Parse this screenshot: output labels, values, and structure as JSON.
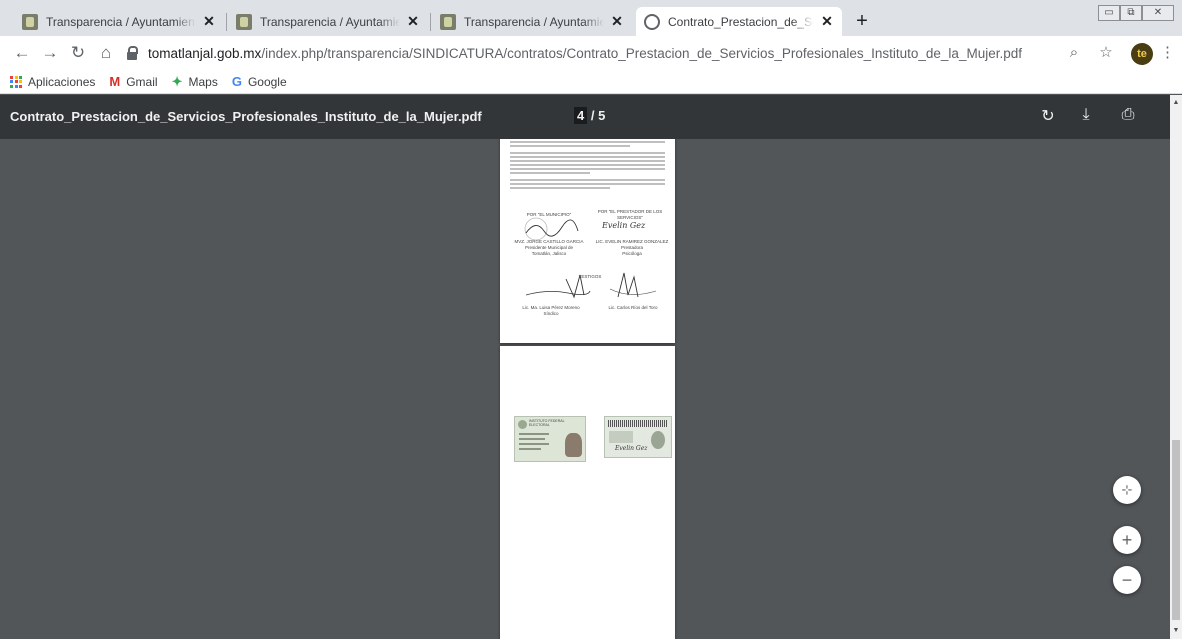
{
  "tabs": [
    {
      "title": "Transparencia / Ayuntamiento de",
      "active": false
    },
    {
      "title": "Transparencia / Ayuntamiento de",
      "active": false
    },
    {
      "title": "Transparencia / Ayuntamiento de",
      "active": false
    },
    {
      "title": "Contrato_Prestacion_de_Servicios",
      "active": true
    }
  ],
  "tab_close_glyph": "✕",
  "new_tab_glyph": "+",
  "address": {
    "domain": "tomatlanjal.gob.mx",
    "path": "/index.php/transparencia/SINDICATURA/contratos/Contrato_Prestacion_de_Servicios_Profesionales_Instituto_de_la_Mujer.pdf"
  },
  "profile_initials": "te",
  "bookmarks": [
    {
      "label": "Aplicaciones",
      "icon": "apps-grid-icon"
    },
    {
      "label": "Gmail",
      "icon": "gmail-icon",
      "glyph": "M",
      "color": "#d93025"
    },
    {
      "label": "Maps",
      "icon": "maps-pin-icon",
      "glyph": "✦",
      "color": "#34a853"
    },
    {
      "label": "Google",
      "icon": "google-g-icon",
      "glyph": "G",
      "color": "#4285f4"
    }
  ],
  "pdf": {
    "filename": "Contrato_Prestacion_de_Servicios_Profesionales_Instituto_de_la_Mujer.pdf",
    "current_page": "4",
    "page_separator": "/ 5"
  },
  "signature_page": {
    "label_municipio": "POR \"EL MUNICIPIO\"",
    "label_prestador_1": "POR \"EL PRESTADOR DE LOS",
    "label_prestador_2": "SERVICIOS\"",
    "name_left": "MVZ. JORGE CASTILLO GARCIA",
    "role_left_1": "Presidente Municipal de",
    "role_left_2": "Tomatlán, Jalisco",
    "name_right": "LIC. EVELIN RAMIREZ GONZALEZ",
    "role_right_1": "Prestadora",
    "role_right_2": "Psicóloga",
    "label_testigos": "TESTIGOS",
    "name_witness_left": "Lic. Ma. Luisa Pérez Moreno",
    "role_witness_left": "Síndico",
    "name_witness_right": "Lic. Carlos Ríos del Toro",
    "signature_text": "Evelin Gez"
  },
  "id_page": {
    "card_header": "INSTITUTO FEDERAL ELECTORAL",
    "card_back_signature": "Evelin Gez"
  },
  "colors": {
    "viewer_bg": "#525659",
    "pdf_toolbar": "#323639",
    "tabstrip": "#dee1e6",
    "accent_blue": "#1a73e8"
  }
}
